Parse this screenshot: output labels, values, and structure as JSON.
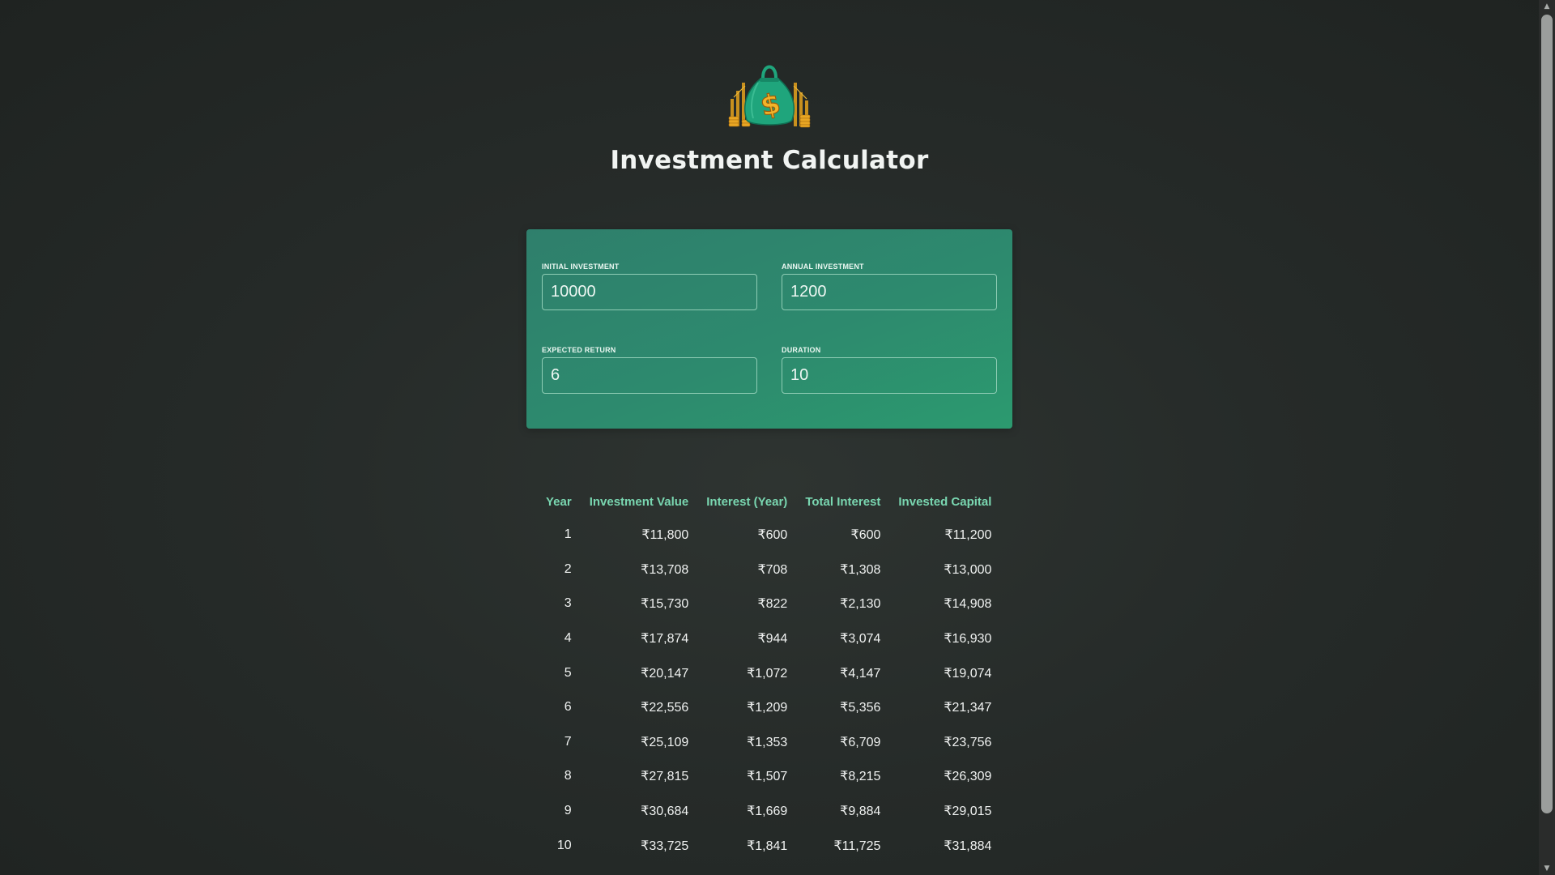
{
  "header": {
    "title": "Investment Calculator"
  },
  "form": {
    "initial_investment": {
      "label": "Initial Investment",
      "value": "10000"
    },
    "annual_investment": {
      "label": "Annual Investment",
      "value": "1200"
    },
    "expected_return": {
      "label": "Expected Return",
      "value": "6"
    },
    "duration": {
      "label": "Duration",
      "value": "10"
    }
  },
  "results": {
    "headers": [
      "Year",
      "Investment Value",
      "Interest (Year)",
      "Total Interest",
      "Invested Capital"
    ],
    "rows": [
      [
        "1",
        "₹11,800",
        "₹600",
        "₹600",
        "₹11,200"
      ],
      [
        "2",
        "₹13,708",
        "₹708",
        "₹1,308",
        "₹13,000"
      ],
      [
        "3",
        "₹15,730",
        "₹822",
        "₹2,130",
        "₹14,908"
      ],
      [
        "4",
        "₹17,874",
        "₹944",
        "₹3,074",
        "₹16,930"
      ],
      [
        "5",
        "₹20,147",
        "₹1,072",
        "₹4,147",
        "₹19,074"
      ],
      [
        "6",
        "₹22,556",
        "₹1,209",
        "₹5,356",
        "₹21,347"
      ],
      [
        "7",
        "₹25,109",
        "₹1,353",
        "₹6,709",
        "₹23,756"
      ],
      [
        "8",
        "₹27,815",
        "₹1,507",
        "₹8,215",
        "₹26,309"
      ],
      [
        "9",
        "₹30,684",
        "₹1,669",
        "₹9,884",
        "₹29,015"
      ],
      [
        "10",
        "₹33,725",
        "₹1,841",
        "₹11,725",
        "₹31,884"
      ]
    ]
  },
  "icons": {
    "logo": "money-bag-icon",
    "scroll_up": "triangle-up-icon",
    "scroll_down": "triangle-down-icon"
  },
  "colors": {
    "accent": "#79d6b0",
    "card": "#2d8a6e",
    "logo_gold": "#e9a623",
    "logo_green": "#1fa57c"
  }
}
